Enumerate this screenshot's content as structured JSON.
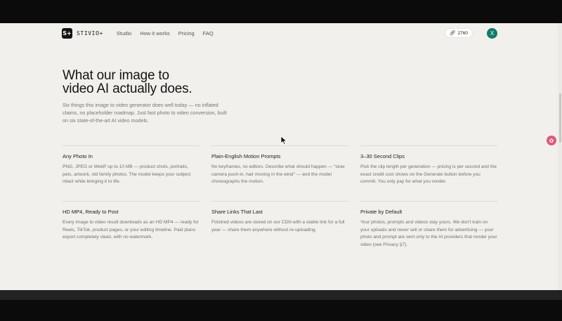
{
  "nav": {
    "logo_mark": "S+",
    "logo_text": "STIVIO+",
    "links": [
      "Studio",
      "How it works",
      "Pricing",
      "FAQ"
    ],
    "credits": "2760",
    "avatar_initial": "X"
  },
  "hero": {
    "title_line1": "What our image to",
    "title_line2": "video AI actually does.",
    "intro": "Six things this image to video generator does well today — no inflated claims, no placeholder roadmap. Just fast photo to video conversion, built on six state-of-the-art AI video models."
  },
  "features": [
    {
      "title": "Any Photo In",
      "desc": "PNG, JPEG or WebP up to 10 MB — product shots, portraits, pets, artwork, old family photos. The model keeps your subject intact while bringing it to life."
    },
    {
      "title": "Plain-English Motion Prompts",
      "desc": "No keyframes, no editors. Describe what should happen — \"slow camera push-in, hair moving in the wind\" — and the model choreographs the motion."
    },
    {
      "title": "3–30 Second Clips",
      "desc": "Pick the clip length per generation — pricing is per second and the exact credit cost shows on the Generate button before you commit. You only pay for what you render."
    },
    {
      "title": "HD MP4, Ready to Post",
      "desc": "Every image to video result downloads as an HD MP4 — ready for Reels, TikTok, product pages, or your editing timeline. Paid plans export completely clean, with no watermark."
    },
    {
      "title": "Share Links That Last",
      "desc": "Finished videos are stored on our CDN with a stable link for a full year — share them anywhere without re-uploading."
    },
    {
      "title": "Private by Default",
      "desc": "Your photos, prompts and videos stay yours. We don't train on your uploads and never sell or share them for advertising — your photo and prompt are sent only to the AI providers that render your video (see Privacy §7)."
    }
  ],
  "colors": {
    "page_bg": "#f1f0ec",
    "accent_avatar": "#0f7b6c",
    "side_badge": "#e2577a"
  },
  "icons": {
    "credit": "link-icon",
    "side_badge": "flower-icon",
    "cursor": "mouse-pointer-icon"
  }
}
